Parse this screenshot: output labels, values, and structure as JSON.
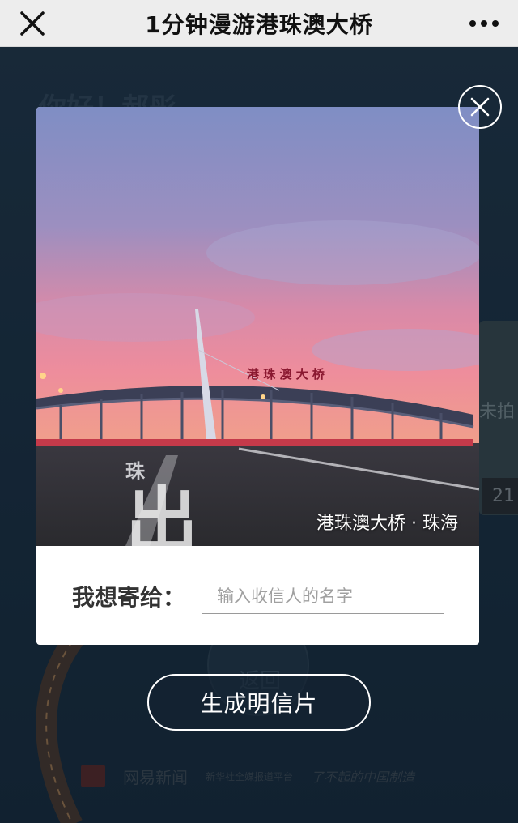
{
  "topbar": {
    "title": "1分钟漫游港珠澳大桥",
    "close_icon": "close-icon",
    "more_icon": "more-dots-icon"
  },
  "background": {
    "greeting": "你好！郝彤",
    "side_text": "未拍",
    "side_number": "21",
    "back_label": "返回",
    "logos": [
      "网易新闻",
      "新华社全媒报道平台",
      "了不起的中国制造"
    ]
  },
  "modal": {
    "photo_caption": "港珠澳大桥 · 珠海",
    "photo_sign": "港 珠 澳 大 桥",
    "road_text_small": "珠",
    "road_text_large": "出",
    "send_label": "我想寄给：",
    "send_placeholder": "输入收信人的名字",
    "send_value": ""
  },
  "generate_button_label": "生成明信片",
  "colors": {
    "topbar_bg": "#ededed",
    "background": "#1a2b3a",
    "sky_top": "#8e99c9",
    "sky_bottom": "#e88aa6",
    "road": "#2e2e33"
  }
}
